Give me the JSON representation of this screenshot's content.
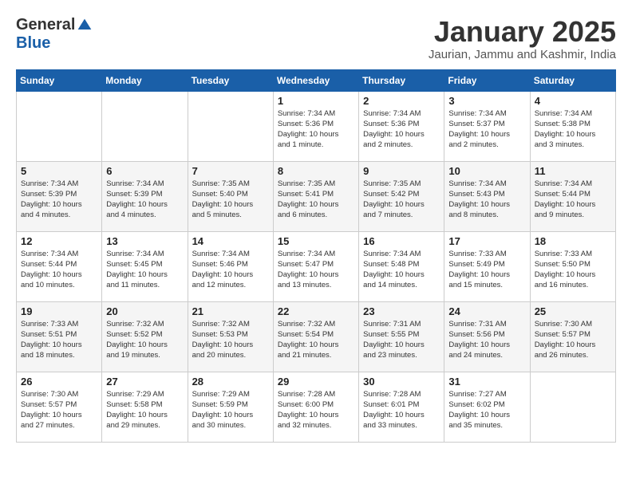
{
  "header": {
    "logo_general": "General",
    "logo_blue": "Blue",
    "title": "January 2025",
    "subtitle": "Jaurian, Jammu and Kashmir, India"
  },
  "weekdays": [
    "Sunday",
    "Monday",
    "Tuesday",
    "Wednesday",
    "Thursday",
    "Friday",
    "Saturday"
  ],
  "weeks": [
    [
      {
        "day": "",
        "info": ""
      },
      {
        "day": "",
        "info": ""
      },
      {
        "day": "",
        "info": ""
      },
      {
        "day": "1",
        "info": "Sunrise: 7:34 AM\nSunset: 5:36 PM\nDaylight: 10 hours\nand 1 minute."
      },
      {
        "day": "2",
        "info": "Sunrise: 7:34 AM\nSunset: 5:36 PM\nDaylight: 10 hours\nand 2 minutes."
      },
      {
        "day": "3",
        "info": "Sunrise: 7:34 AM\nSunset: 5:37 PM\nDaylight: 10 hours\nand 2 minutes."
      },
      {
        "day": "4",
        "info": "Sunrise: 7:34 AM\nSunset: 5:38 PM\nDaylight: 10 hours\nand 3 minutes."
      }
    ],
    [
      {
        "day": "5",
        "info": "Sunrise: 7:34 AM\nSunset: 5:39 PM\nDaylight: 10 hours\nand 4 minutes."
      },
      {
        "day": "6",
        "info": "Sunrise: 7:34 AM\nSunset: 5:39 PM\nDaylight: 10 hours\nand 4 minutes."
      },
      {
        "day": "7",
        "info": "Sunrise: 7:35 AM\nSunset: 5:40 PM\nDaylight: 10 hours\nand 5 minutes."
      },
      {
        "day": "8",
        "info": "Sunrise: 7:35 AM\nSunset: 5:41 PM\nDaylight: 10 hours\nand 6 minutes."
      },
      {
        "day": "9",
        "info": "Sunrise: 7:35 AM\nSunset: 5:42 PM\nDaylight: 10 hours\nand 7 minutes."
      },
      {
        "day": "10",
        "info": "Sunrise: 7:34 AM\nSunset: 5:43 PM\nDaylight: 10 hours\nand 8 minutes."
      },
      {
        "day": "11",
        "info": "Sunrise: 7:34 AM\nSunset: 5:44 PM\nDaylight: 10 hours\nand 9 minutes."
      }
    ],
    [
      {
        "day": "12",
        "info": "Sunrise: 7:34 AM\nSunset: 5:44 PM\nDaylight: 10 hours\nand 10 minutes."
      },
      {
        "day": "13",
        "info": "Sunrise: 7:34 AM\nSunset: 5:45 PM\nDaylight: 10 hours\nand 11 minutes."
      },
      {
        "day": "14",
        "info": "Sunrise: 7:34 AM\nSunset: 5:46 PM\nDaylight: 10 hours\nand 12 minutes."
      },
      {
        "day": "15",
        "info": "Sunrise: 7:34 AM\nSunset: 5:47 PM\nDaylight: 10 hours\nand 13 minutes."
      },
      {
        "day": "16",
        "info": "Sunrise: 7:34 AM\nSunset: 5:48 PM\nDaylight: 10 hours\nand 14 minutes."
      },
      {
        "day": "17",
        "info": "Sunrise: 7:33 AM\nSunset: 5:49 PM\nDaylight: 10 hours\nand 15 minutes."
      },
      {
        "day": "18",
        "info": "Sunrise: 7:33 AM\nSunset: 5:50 PM\nDaylight: 10 hours\nand 16 minutes."
      }
    ],
    [
      {
        "day": "19",
        "info": "Sunrise: 7:33 AM\nSunset: 5:51 PM\nDaylight: 10 hours\nand 18 minutes."
      },
      {
        "day": "20",
        "info": "Sunrise: 7:32 AM\nSunset: 5:52 PM\nDaylight: 10 hours\nand 19 minutes."
      },
      {
        "day": "21",
        "info": "Sunrise: 7:32 AM\nSunset: 5:53 PM\nDaylight: 10 hours\nand 20 minutes."
      },
      {
        "day": "22",
        "info": "Sunrise: 7:32 AM\nSunset: 5:54 PM\nDaylight: 10 hours\nand 21 minutes."
      },
      {
        "day": "23",
        "info": "Sunrise: 7:31 AM\nSunset: 5:55 PM\nDaylight: 10 hours\nand 23 minutes."
      },
      {
        "day": "24",
        "info": "Sunrise: 7:31 AM\nSunset: 5:56 PM\nDaylight: 10 hours\nand 24 minutes."
      },
      {
        "day": "25",
        "info": "Sunrise: 7:30 AM\nSunset: 5:57 PM\nDaylight: 10 hours\nand 26 minutes."
      }
    ],
    [
      {
        "day": "26",
        "info": "Sunrise: 7:30 AM\nSunset: 5:57 PM\nDaylight: 10 hours\nand 27 minutes."
      },
      {
        "day": "27",
        "info": "Sunrise: 7:29 AM\nSunset: 5:58 PM\nDaylight: 10 hours\nand 29 minutes."
      },
      {
        "day": "28",
        "info": "Sunrise: 7:29 AM\nSunset: 5:59 PM\nDaylight: 10 hours\nand 30 minutes."
      },
      {
        "day": "29",
        "info": "Sunrise: 7:28 AM\nSunset: 6:00 PM\nDaylight: 10 hours\nand 32 minutes."
      },
      {
        "day": "30",
        "info": "Sunrise: 7:28 AM\nSunset: 6:01 PM\nDaylight: 10 hours\nand 33 minutes."
      },
      {
        "day": "31",
        "info": "Sunrise: 7:27 AM\nSunset: 6:02 PM\nDaylight: 10 hours\nand 35 minutes."
      },
      {
        "day": "",
        "info": ""
      }
    ]
  ]
}
